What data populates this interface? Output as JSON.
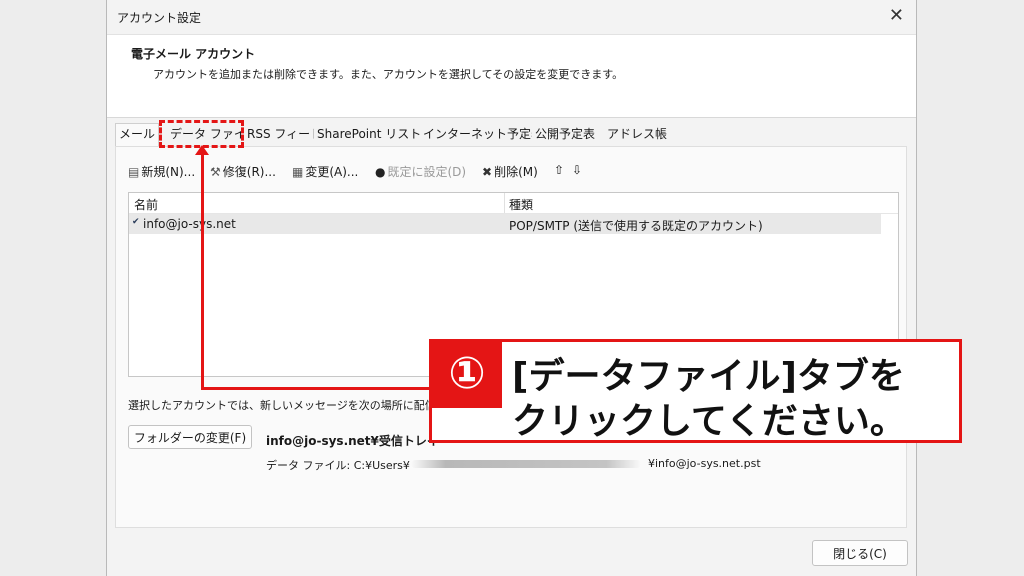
{
  "window": {
    "title": "アカウント設定",
    "close_glyph": "✕"
  },
  "header": {
    "title": "電子メール アカウント",
    "description": "アカウントを追加または削除できます。また、アカウントを選択してその設定を変更できます。"
  },
  "tabs": [
    {
      "label": "メール",
      "active": true
    },
    {
      "label": "データ ファイル",
      "active": false
    },
    {
      "label": "RSS フィード",
      "active": false
    },
    {
      "label": "SharePoint リスト",
      "active": false
    },
    {
      "label": "インターネット予定表",
      "active": false
    },
    {
      "label": "公開予定表",
      "active": false
    },
    {
      "label": "アドレス帳",
      "active": false
    }
  ],
  "toolbar": {
    "new_label": "新規(N)...",
    "repair_label": "修復(R)...",
    "change_label": "変更(A)...",
    "default_label": "既定に設定(D)",
    "remove_label": "削除(M)",
    "up_glyph": "⇧",
    "down_glyph": "⇩"
  },
  "list": {
    "columns": [
      "名前",
      "種類"
    ],
    "rows": [
      {
        "name": "info@jo-sys.net",
        "type": "POP/SMTP (送信で使用する既定のアカウント)",
        "default": true
      }
    ]
  },
  "delivery": {
    "text": "選択したアカウントでは、新しいメッセージを次の場所に配信し",
    "folder_button": "フォルダーの変更(F)",
    "inbox_path": "info@jo-sys.net¥受信トレイ",
    "datafile_prefix": "データ ファイル: C:¥Users¥",
    "datafile_suffix": "¥info@jo-sys.net.pst"
  },
  "close_button": "閉じる(C)",
  "annotation": {
    "number": "①",
    "line1": "[データファイル]タブを",
    "line2": "クリックしてください。",
    "color": "#e41515"
  }
}
